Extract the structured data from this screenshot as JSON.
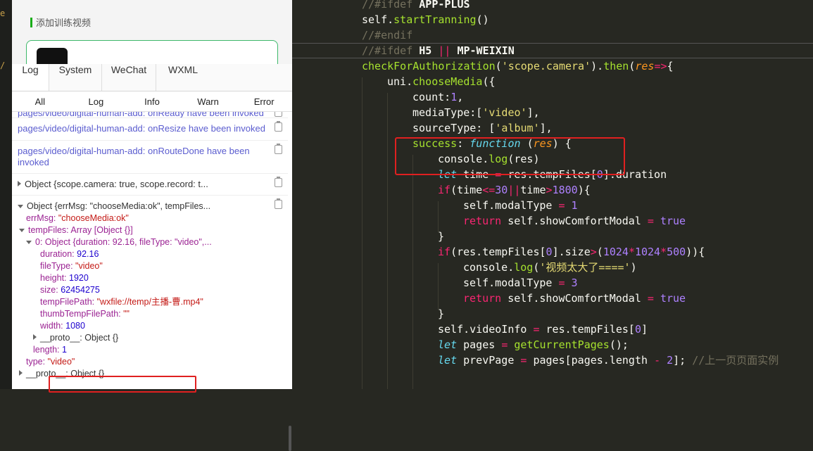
{
  "left_strip": {
    "glyph_top": "e",
    "glyph_bottom": "/"
  },
  "simulator": {
    "section_title": "添加训练视频"
  },
  "console": {
    "tabs": [
      {
        "label": "Log"
      },
      {
        "label": "System"
      },
      {
        "label": "WeChat"
      },
      {
        "label": "WXML"
      }
    ],
    "filters": [
      "All",
      "Log",
      "Info",
      "Warn",
      "Error"
    ],
    "logs": [
      "pages/video/digital-human-add: onReady have been invoked",
      "pages/video/digital-human-add: onResize have been invoked",
      "pages/video/digital-human-add: onRouteDone have been invoked",
      "Object {scope.camera: true, scope.record: t...",
      "Object {errMsg: \"chooseMedia:ok\", tempFiles..."
    ],
    "tree": {
      "errMsg_key": "errMsg:",
      "errMsg_val": "\"chooseMedia:ok\"",
      "tempFiles": "tempFiles: Array [Object {}]",
      "item0": "0: Object {duration: 92.16, fileType: \"video\",...",
      "duration_key": "duration:",
      "duration_val": "92.16",
      "fileType_key": "fileType:",
      "fileType_val": "\"video\"",
      "height_key": "height:",
      "height_val": "1920",
      "size_key": "size:",
      "size_val": "62454275",
      "tempFilePath_key": "tempFilePath:",
      "tempFilePath_val": "\"wxfile://temp/主播-曹.mp4\"",
      "thumb_key": "thumbTempFilePath:",
      "thumb_val": "\"\"",
      "width_key": "width:",
      "width_val": "1080",
      "proto_inner": "__proto__: Object {}",
      "length_key": "length:",
      "length_val": "1",
      "type_key": "type:",
      "type_val": "\"video\"",
      "proto_outer": "__proto__: Object {}"
    }
  },
  "code": {
    "l1": {
      "a": "//#ifdef",
      "b": "APP-PLUS"
    },
    "l2": {
      "a": "self",
      "b": ".",
      "c": "startTranning",
      "d": "()"
    },
    "l3": "//#endif",
    "l4": {
      "a": "//#ifdef",
      "b": "H5",
      "c": "||",
      "d": "MP-WEIXIN"
    },
    "l5": {
      "a": "checkForAuthorization",
      "b": "(",
      "c": "'scope.camera'",
      "d": ").",
      "e": "then",
      "f": "(",
      "g": "res",
      "h": "=>",
      "i": "{"
    },
    "l6": {
      "a": "uni",
      "b": ".",
      "c": "chooseMedia",
      "d": "({"
    },
    "l7": {
      "a": "count:",
      "b": "1",
      "c": ","
    },
    "l8": {
      "a": "mediaType:[",
      "b": "'video'",
      "c": "],"
    },
    "l9": {
      "a": "sourceType: [",
      "b": "'album'",
      "c": "],"
    },
    "l10": {
      "a": "success",
      "b": ":",
      "c": "function",
      "d": "(",
      "e": "res",
      "f": ") {"
    },
    "l11": {
      "a": "console",
      "b": ".",
      "c": "log",
      "d": "(res)"
    },
    "l12": {
      "a": "let",
      "b": "time",
      "c": "=",
      "d": "res.tempFiles[",
      "e": "0",
      "f": "].duration"
    },
    "l13": {
      "a": "if",
      "b": "(time",
      "c": "<=",
      "d": "30",
      "e": "||",
      "f": "time",
      "g": ">",
      "h": "1800",
      "i": "){"
    },
    "l14": {
      "a": "self.modalType",
      "b": "=",
      "c": "1"
    },
    "l15": {
      "a": "return",
      "b": "self.showComfortModal",
      "c": "=",
      "d": "true"
    },
    "l16": "}",
    "l17": {
      "a": "if",
      "b": "(res.tempFiles[",
      "c": "0",
      "d": "].size",
      "e": ">",
      "f": "(",
      "g": "1024",
      "h": "*",
      "i": "1024",
      "j": "*",
      "k": "500",
      "l": ")){"
    },
    "l18": {
      "a": "console",
      "b": ".",
      "c": "log",
      "d": "(",
      "e": "'视频太大了===='",
      "f": ")"
    },
    "l19": {
      "a": "self.modalType",
      "b": "=",
      "c": "3"
    },
    "l20": {
      "a": "return",
      "b": "self.showComfortModal",
      "c": "=",
      "d": "true"
    },
    "l21": "}",
    "l22": {
      "a": "self.videoInfo",
      "b": "=",
      "c": "res.tempFiles[",
      "d": "0",
      "e": "]"
    },
    "l23": {
      "a": "let",
      "b": "pages",
      "c": "=",
      "d": "getCurrentPages",
      "e": "();"
    },
    "l24": {
      "a": "let",
      "b": "prevPage",
      "c": "=",
      "d": "pages[pages.length",
      "e": "-",
      "f": "2",
      "g": "];",
      "h": "//上一页页面实例"
    }
  },
  "colors": {
    "annotation_box": "#e02020",
    "editor_bg": "#272822",
    "keyword": "#f92672",
    "function": "#a6e22e",
    "string": "#e6db74",
    "number": "#ae81ff"
  }
}
